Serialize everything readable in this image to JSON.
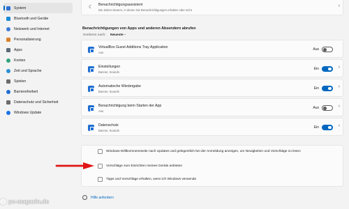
{
  "sidebar": {
    "items": [
      {
        "label": "System",
        "active": true,
        "color": "#2b6fd6"
      },
      {
        "label": "Bluetooth und Geräte",
        "color": "#1c8bd6"
      },
      {
        "label": "Netzwerk und Internet",
        "color": "#3a7bd5"
      },
      {
        "label": "Personalisierung",
        "color": "#d9822b"
      },
      {
        "label": "Apps",
        "color": "#5a6b7b"
      },
      {
        "label": "Konten",
        "color": "#2fa37a"
      },
      {
        "label": "Zeit und Sprache",
        "color": "#2b8fd6"
      },
      {
        "label": "Spielen",
        "color": "#6b6b6b"
      },
      {
        "label": "Barrierefreiheit",
        "color": "#1f6fd1"
      },
      {
        "label": "Datenschutz und Sicherheit",
        "color": "#6b6b6b"
      },
      {
        "label": "Windows Update",
        "color": "#1a73e8"
      }
    ]
  },
  "top_card": {
    "title": "Benachrichtigungsassistent",
    "subtitle": "Die Zeiten steuern, in denen Sie Benachrichtigungen erhalten oder nicht"
  },
  "section": {
    "header": "Benachrichtigungen von Apps und anderen Absendern abrufen",
    "sort_label": "Sortieren nach:",
    "sort_value": "Neueste"
  },
  "apps": [
    {
      "title": "VirtualBox Guest Additions Tray Application",
      "subtitle": "Aus",
      "state": "Aus",
      "on": false
    },
    {
      "title": "Einstellungen",
      "subtitle": "Banner, Sounds",
      "state": "Ein",
      "on": true
    },
    {
      "title": "Automatische Wiedergabe",
      "subtitle": "Banner, Sounds",
      "state": "Ein",
      "on": true
    },
    {
      "title": "Benachrichtigung beim Starten der App",
      "subtitle": "Aus",
      "state": "Aus",
      "on": false
    },
    {
      "title": "Datenschutz",
      "subtitle": "Banner, Sounds",
      "state": "Ein",
      "on": true
    }
  ],
  "checkboxes": [
    {
      "label": "Windows-Willkommensseite nach Updates und gelegentlich bei der Anmeldung anzeigen, um Neuigkeiten und Vorschläge zu lesen",
      "checked": false
    },
    {
      "label": "Vorschläge zum Einrichten meines Geräts anbieten",
      "checked": false
    },
    {
      "label": "Tipps und Vorschläge erhalten, wenn ich Windows verwende",
      "checked": false
    }
  ],
  "help": {
    "label": "Hilfe anfordern"
  },
  "watermark": "pc-magazin.de",
  "colors": {
    "accent": "#0067c0",
    "arrow": "#e01515"
  }
}
